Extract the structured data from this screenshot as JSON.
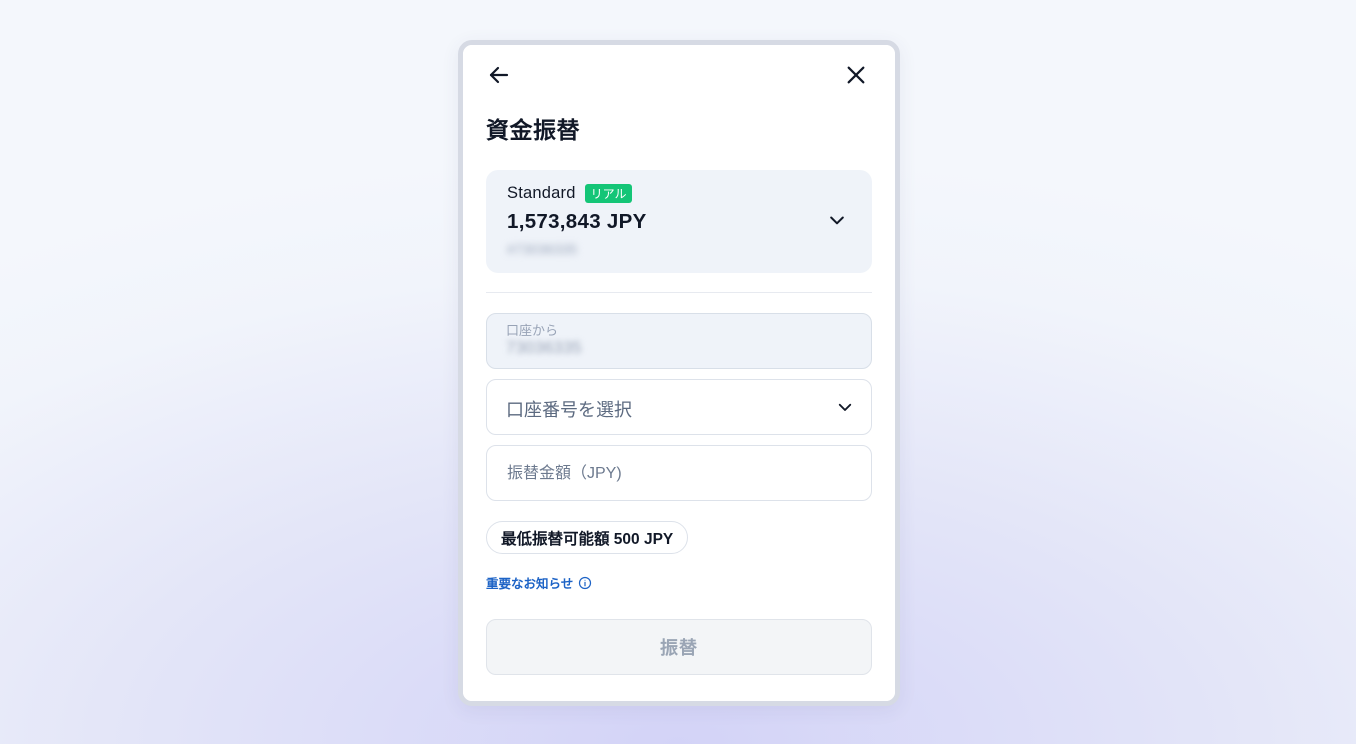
{
  "dialog": {
    "title": "資金振替"
  },
  "source_account": {
    "type": "Standard",
    "badge": "リアル",
    "balance": "1,573,843 JPY",
    "number": "#73036335"
  },
  "from_field": {
    "label": "口座から",
    "value": "73036335"
  },
  "destination_select": {
    "placeholder": "口座番号を選択"
  },
  "amount_field": {
    "placeholder": "振替金額（JPY)"
  },
  "minimum_chip": {
    "label": "最低振替可能額 500 JPY"
  },
  "notice": {
    "label": "重要なお知らせ"
  },
  "submit": {
    "label": "振替"
  },
  "icons": {
    "back": "arrow-left-icon",
    "close": "close-icon",
    "chevron": "chevron-down-icon",
    "info": "info-icon"
  },
  "colors": {
    "badge_green": "#14c577",
    "link_blue": "#1d63c6",
    "card_bg": "#eff3f9",
    "text_dark": "#111827",
    "disabled_text": "#9aa5b5"
  }
}
